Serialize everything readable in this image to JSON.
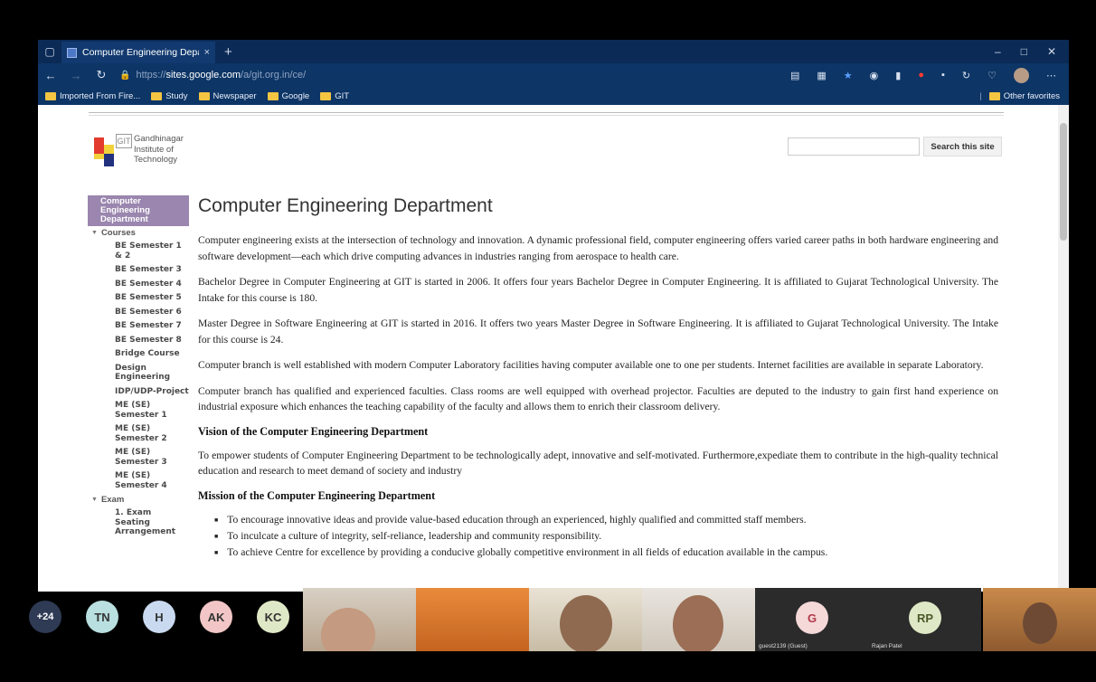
{
  "browser": {
    "tab_title": "Computer Engineering Departm",
    "tab_close": "×",
    "new_tab": "+",
    "url_protocol": "https://",
    "url_host": "sites.google.com",
    "url_path": "/a/git.org.in/ce/",
    "bookmarks": [
      "Imported From Fire...",
      "Study",
      "Newspaper",
      "Google",
      "GIT"
    ],
    "other_favorites": "Other favorites"
  },
  "site": {
    "logo_letters": "GIT",
    "logo_text": [
      "Gandhinagar",
      "Institute of",
      "Technology"
    ],
    "search_button": "Search this site",
    "search_placeholder": ""
  },
  "sidebar": {
    "active_item": "Computer Engineering Department",
    "groups": [
      {
        "label": "Courses",
        "items": [
          "BE Semester 1 & 2",
          "BE Semester 3",
          "BE Semester 4",
          "BE Semester 5",
          "BE Semester 6",
          "BE Semester 7",
          "BE Semester 8",
          "Bridge Course",
          "Design Engineering",
          "IDP/UDP-Project",
          "ME (SE) Semester 1",
          "ME (SE) Semester 2",
          "ME (SE) Semester 3",
          "ME (SE) Semester 4"
        ]
      },
      {
        "label": "Exam",
        "items": [
          "1. Exam Seating Arrangement"
        ]
      }
    ]
  },
  "main": {
    "title": "Computer Engineering Department",
    "paragraphs": [
      "Computer engineering exists at the intersection of technology and innovation. A dynamic professional field, computer engineering offers varied career paths in both hardware engineering and software development—each which drive computing advances in industries ranging from aerospace to health care.",
      "Bachelor Degree in Computer Engineering at GIT is started in 2006. It offers four years Bachelor Degree in Computer Engineering. It is affiliated to Gujarat Technological University. The Intake for this course is 180.",
      "Master Degree in Software Engineering at GIT is started in 2016. It offers two years Master Degree in Software Engineering. It is affiliated to Gujarat Technological University. The Intake for this course is 24.",
      "Computer branch is well established with modern Computer Laboratory facilities having computer available one to one per students. Internet facilities are available in separate Laboratory.",
      "Computer branch has qualified and experienced faculties. Class rooms are well equipped with overhead projector. Faculties are deputed to the industry to gain first hand experience on industrial exposure which enhances the teaching capability of the faculty and allows them to enrich their classroom delivery."
    ],
    "vision_heading": "Vision of the Computer Engineering Department",
    "vision_text": "To empower students of Computer Engineering Department to be technologically adept, innovative and self-motivated. Furthermore,expediate them to contribute in the high-quality technical education and research to meet demand of society and industry",
    "mission_heading": "Mission of the Computer Engineering  Department",
    "mission_items": [
      "To encourage innovative ideas and provide value-based education through an experienced, highly qualified and committed staff members.",
      "To inculcate a culture of integrity, self-reliance, leadership and community responsibility.",
      "To achieve Centre for excellence by providing a conducive globally competitive environment in all fields of education available in the campus."
    ]
  },
  "meeting": {
    "more_count": "+24",
    "participants": [
      {
        "initials": "TN",
        "color": "#b9dfe0"
      },
      {
        "initials": "H",
        "color": "#c9d9ef"
      },
      {
        "initials": "AK",
        "color": "#f2c6c6"
      },
      {
        "initials": "KC",
        "color": "#dfe8c6"
      }
    ],
    "guest_initial": "G",
    "guest_name": "guest2139 (Guest)",
    "rajan_initials": "RP",
    "rajan_name": "Rajan Patel"
  }
}
